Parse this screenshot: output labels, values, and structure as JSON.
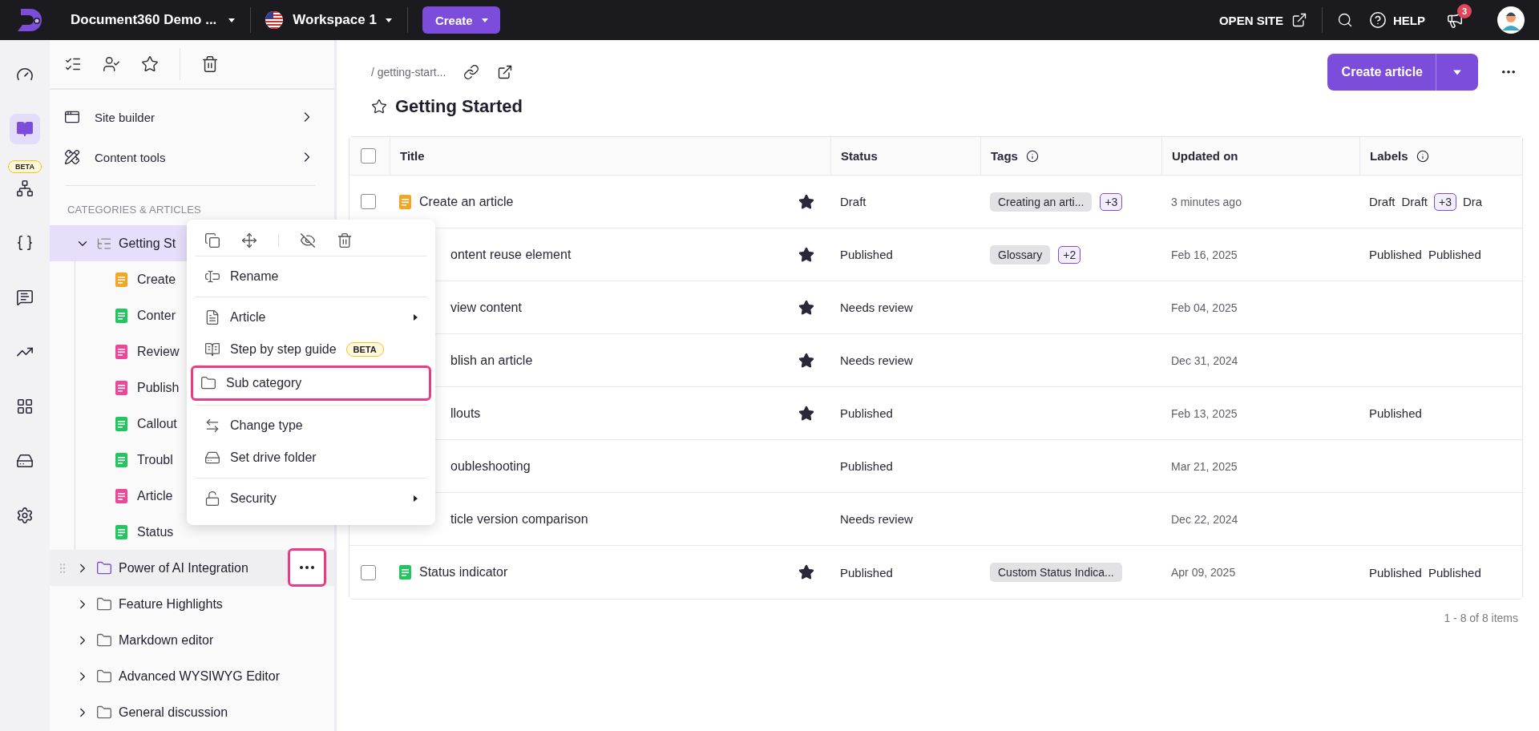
{
  "topbar": {
    "project": "Document360 Demo ...",
    "workspace": "Workspace 1",
    "create_button": "Create",
    "open_site": "OPEN SITE",
    "help": "HELP",
    "notification_count": "3"
  },
  "rail": {
    "items": [
      {
        "selected": false
      },
      {
        "selected": true
      },
      {
        "selected": false,
        "badge": "BETA"
      },
      {
        "selected": false
      },
      {
        "selected": false
      },
      {
        "selected": false
      },
      {
        "selected": false
      },
      {
        "selected": false
      },
      {
        "selected": false
      }
    ]
  },
  "sidebar": {
    "nav": [
      {
        "label": "Site builder"
      },
      {
        "label": "Content tools"
      }
    ],
    "section_title": "CATEGORIES & ARTICLES",
    "categories": [
      {
        "label": "Getting St",
        "selected": true,
        "expanded": true,
        "hovered": false,
        "children": [
          {
            "label": "Create",
            "color": "#f5a524"
          },
          {
            "label": "Conter",
            "color": "#22c55e"
          },
          {
            "label": "Review",
            "color": "#ec4899"
          },
          {
            "label": "Publish",
            "color": "#ec4899"
          },
          {
            "label": "Callout",
            "color": "#22c55e"
          },
          {
            "label": "Troubl",
            "color": "#22c55e"
          },
          {
            "label": "Article",
            "color": "#ec4899"
          },
          {
            "label": "Status",
            "color": "#22c55e"
          }
        ]
      },
      {
        "label": "Power of AI Integration",
        "selected": false,
        "expanded": false,
        "hovered": true
      },
      {
        "label": "Feature Highlights",
        "selected": false,
        "expanded": false,
        "hovered": false
      },
      {
        "label": "Markdown editor",
        "selected": false,
        "expanded": false,
        "hovered": false
      },
      {
        "label": "Advanced WYSIWYG Editor",
        "selected": false,
        "expanded": false,
        "hovered": false
      },
      {
        "label": "General discussion",
        "selected": false,
        "expanded": false,
        "hovered": false
      }
    ]
  },
  "context_menu": {
    "groups": [
      [
        {
          "label": "Rename",
          "submenu": false,
          "highlighted": false
        }
      ],
      [
        {
          "label": "Article",
          "submenu": true,
          "highlighted": false
        },
        {
          "label": "Step by step guide",
          "badge": "BETA",
          "submenu": false,
          "highlighted": false
        },
        {
          "label": "Sub category",
          "submenu": false,
          "highlighted": true
        }
      ],
      [
        {
          "label": "Change type",
          "submenu": false,
          "highlighted": false
        },
        {
          "label": "Set drive folder",
          "submenu": false,
          "highlighted": false
        }
      ],
      [
        {
          "label": "Security",
          "submenu": true,
          "highlighted": false
        }
      ]
    ]
  },
  "page": {
    "breadcrumb": "/ getting-start...",
    "title": "Getting Started",
    "starred": false,
    "create_button": "Create article"
  },
  "table": {
    "select_all_checked": false,
    "columns": [
      {
        "label": "Title"
      },
      {
        "label": "Status"
      },
      {
        "label": "Tags",
        "info": true
      },
      {
        "label": "Updated on"
      },
      {
        "label": "Labels",
        "info": true
      }
    ],
    "rows": [
      {
        "checked": false,
        "color": "#f5a524",
        "title": "Create an article",
        "starred": true,
        "status": "Draft",
        "tags": [
          {
            "text": "Creating an arti...",
            "kind": "tag"
          },
          {
            "text": "+3",
            "kind": "more"
          }
        ],
        "updated": "3 minutes ago",
        "labels": [
          {
            "text": "Draft",
            "kind": "label"
          },
          {
            "text": "Draft",
            "kind": "label"
          },
          {
            "text": "+3",
            "kind": "more"
          },
          {
            "text": "Dra",
            "kind": "label"
          }
        ]
      },
      {
        "title": "ontent reuse element",
        "starred": true,
        "status": "Published",
        "tags": [
          {
            "text": "Glossary",
            "kind": "tag"
          },
          {
            "text": "+2",
            "kind": "more"
          }
        ],
        "updated": "Feb 16, 2025",
        "labels": [
          {
            "text": "Published",
            "kind": "label"
          },
          {
            "text": "Published",
            "kind": "label"
          }
        ]
      },
      {
        "title": "view content",
        "starred": true,
        "status": "Needs review",
        "updated": "Feb 04, 2025"
      },
      {
        "title": "blish an article",
        "starred": true,
        "status": "Needs review",
        "updated": "Dec 31, 2024"
      },
      {
        "title": "llouts",
        "starred": true,
        "status": "Published",
        "updated": "Feb 13, 2025",
        "labels": [
          {
            "text": "Published",
            "kind": "label"
          }
        ]
      },
      {
        "title": "oubleshooting",
        "starred": false,
        "status": "Published",
        "updated": "Mar 21, 2025"
      },
      {
        "title": "ticle version comparison",
        "starred": false,
        "status": "Needs review",
        "updated": "Dec 22, 2024"
      },
      {
        "checked": false,
        "color": "#22c55e",
        "title": "Status indicator",
        "starred": true,
        "status": "Published",
        "tags": [
          {
            "text": "Custom Status Indica...",
            "kind": "tag"
          }
        ],
        "updated": "Apr 09, 2025",
        "labels": [
          {
            "text": "Published",
            "kind": "label"
          },
          {
            "text": "Published",
            "kind": "label"
          }
        ]
      }
    ]
  },
  "footer": {
    "count": "1 - 8 of 8 items"
  }
}
